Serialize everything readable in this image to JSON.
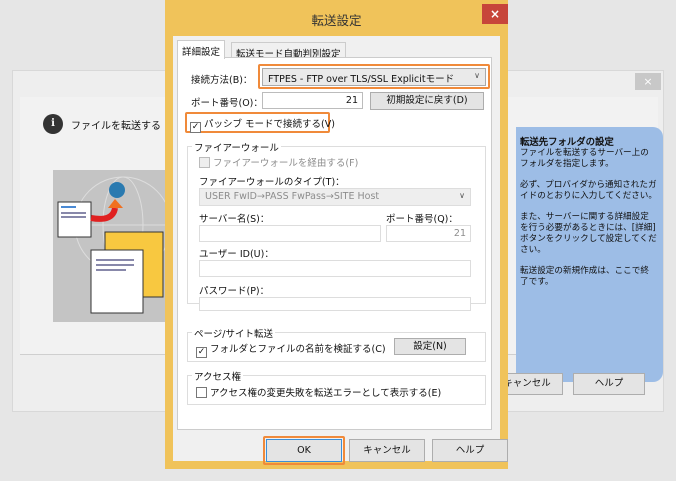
{
  "background_window": {
    "close_icon": "×",
    "info_text": "ファイルを転送する FTP",
    "info_icon": "i",
    "help_panel": {
      "heading": "転送先フォルダの設定",
      "paragraphs": [
        "ファイルを転送するサーバー上のフォルダを指定します。",
        "必ず、プロバイダから通知されたガイドのとおりに入力してください。",
        "また、サーバーに関する詳細設定を行う必要があるときには、[詳細] ボタンをクリックして設定してください。",
        "転送設定の新規作成は、ここで終了です。"
      ]
    },
    "cancel_label": "キャンセル",
    "help_label": "ヘルプ"
  },
  "dialog": {
    "title": "転送設定",
    "close_icon": "×",
    "tabs": [
      {
        "label": "詳細設定",
        "active": true
      },
      {
        "label": "転送モード自動判別設定",
        "active": false
      }
    ],
    "connection_method_label": "接続方法(B)：",
    "connection_method_value": "FTPES - FTP over TLS/SSL Explicitモード",
    "port_label": "ポート番号(O)：",
    "port_value": "21",
    "reset_label": "初期設定に戻す(D)",
    "passive_label": "パッシブ モードで接続する(V)",
    "passive_checked": true,
    "firewall": {
      "group_label": "ファイアーウォール",
      "use_label": "ファイアーウォールを経由する(F)",
      "use_checked": false,
      "type_label": "ファイアーウォールのタイプ(T)：",
      "type_value": "USER FwID→PASS FwPass→SITE Host",
      "server_label": "サーバー名(S)：",
      "server_value": "",
      "port_label": "ポート番号(Q)：",
      "port_value": "21",
      "user_label": "ユーザー ID(U)：",
      "user_value": "",
      "password_label": "パスワード(P)：",
      "password_value": ""
    },
    "page_site": {
      "group_label": "ページ/サイト転送",
      "verify_label": "フォルダとファイルの名前を検証する(C)",
      "verify_checked": true,
      "settings_label": "設定(N)"
    },
    "access": {
      "group_label": "アクセス権",
      "error_label": "アクセス権の変更失敗を転送エラーとして表示する(E)",
      "error_checked": false
    },
    "ok_label": "OK",
    "cancel_label": "キャンセル",
    "help_label": "ヘルプ"
  },
  "colors": {
    "highlight": "#f08a3a",
    "frame": "#f0c35a",
    "close": "#c7453a",
    "help_panel": "#9dbde6"
  }
}
